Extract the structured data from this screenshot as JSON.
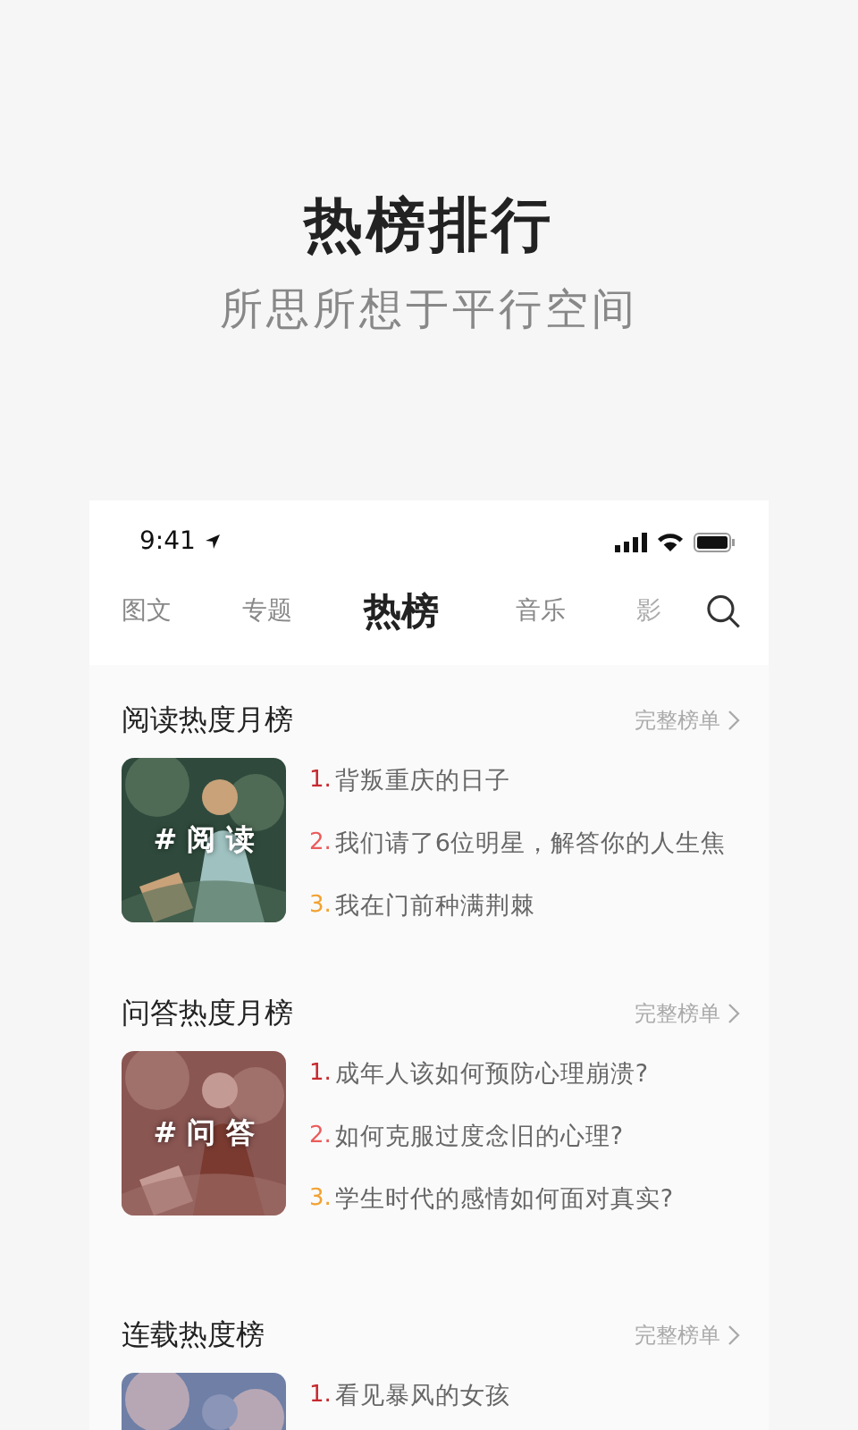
{
  "headline": {
    "title": "热榜排行",
    "subtitle": "所思所想于平行空间"
  },
  "status_bar": {
    "time": "9:41"
  },
  "tabs": [
    {
      "label": "图文",
      "selected": false
    },
    {
      "label": "专题",
      "selected": false
    },
    {
      "label": "热榜",
      "selected": true
    },
    {
      "label": "音乐",
      "selected": false
    },
    {
      "label": "影",
      "selected": false
    }
  ],
  "sections": [
    {
      "title": "阅读热度月榜",
      "more": "完整榜单",
      "cover": {
        "kind": "picture",
        "tag": "# 阅 读"
      },
      "items": [
        {
          "rank": "1.",
          "text": "背叛重庆的日子",
          "color": "#c62a2f"
        },
        {
          "rank": "2.",
          "text": "我们请了6位明星，解答你的人生焦",
          "color": "#ec5b5b"
        },
        {
          "rank": "3.",
          "text": "我在门前种满荆棘",
          "color": "#f2a131"
        }
      ]
    },
    {
      "title": "问答热度月榜",
      "more": "完整榜单",
      "cover": {
        "kind": "picture",
        "tag": "# 问 答"
      },
      "items": [
        {
          "rank": "1.",
          "text": "成年人该如何预防心理崩溃?",
          "color": "#c62a2f"
        },
        {
          "rank": "2.",
          "text": "如何克服过度念旧的心理?",
          "color": "#ec5b5b"
        },
        {
          "rank": "3.",
          "text": "学生时代的感情如何面对真实?",
          "color": "#f2a131"
        }
      ]
    },
    {
      "title": "连载热度榜",
      "more": "完整榜单",
      "items": [
        {
          "rank": "1.",
          "text": "看见暴风的女孩",
          "color": "#c62a2f"
        }
      ]
    }
  ]
}
